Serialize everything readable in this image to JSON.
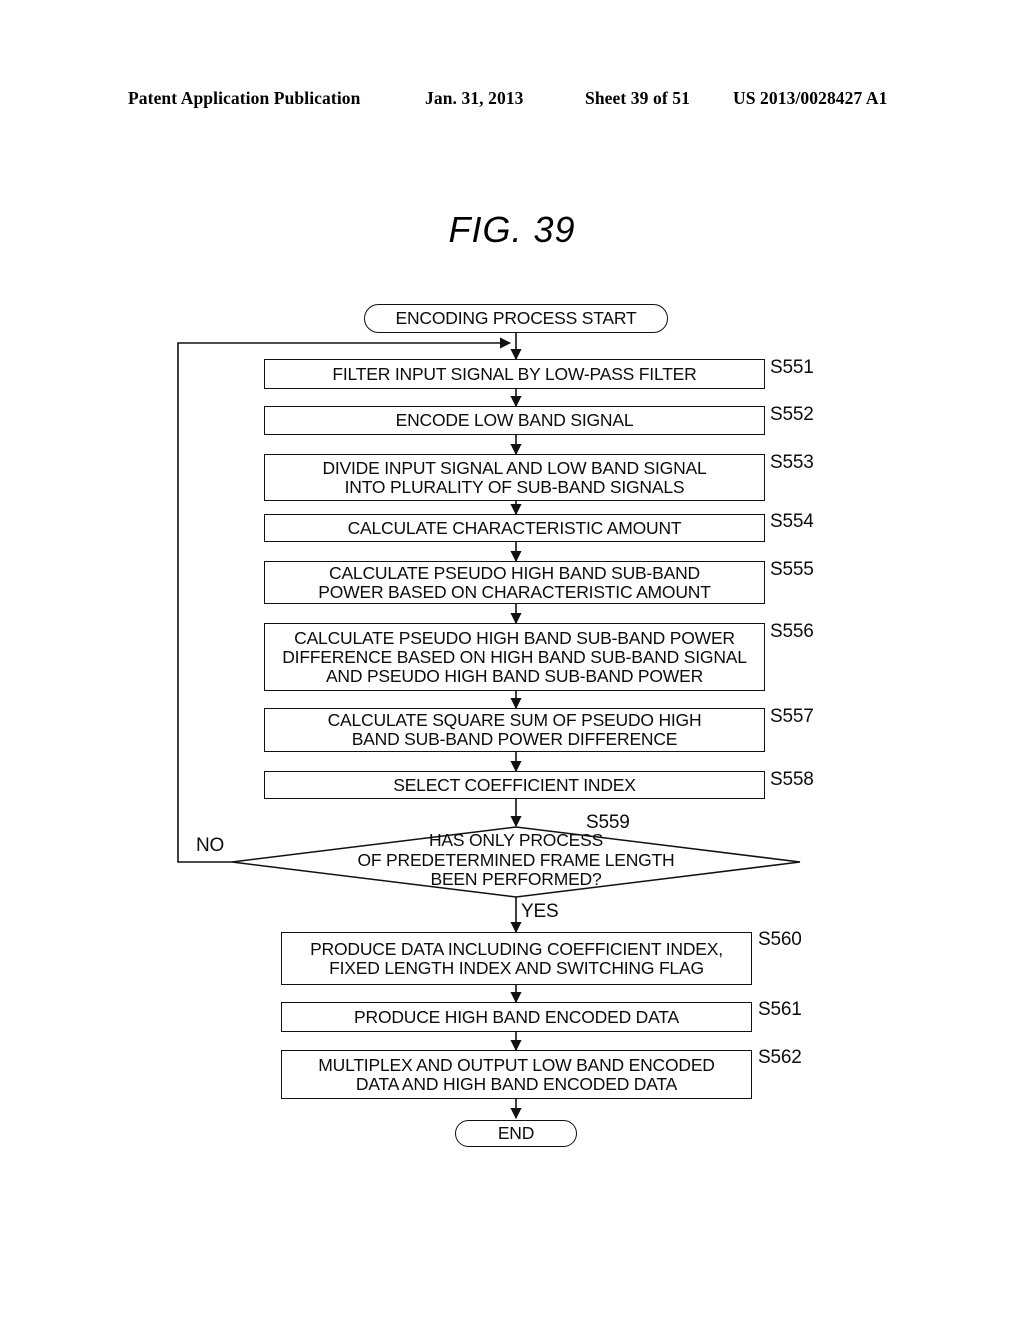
{
  "header": {
    "publication": "Patent Application Publication",
    "date": "Jan. 31, 2013",
    "sheet": "Sheet 39 of 51",
    "number": "US 2013/0028427 A1"
  },
  "figure": {
    "title": "FIG. 39"
  },
  "flowchart": {
    "start": {
      "label": "ENCODING PROCESS START"
    },
    "end": {
      "label": "END"
    },
    "steps": [
      {
        "id": "S551",
        "text": "FILTER INPUT SIGNAL BY LOW-PASS FILTER"
      },
      {
        "id": "S552",
        "text": "ENCODE LOW BAND SIGNAL"
      },
      {
        "id": "S553",
        "text": "DIVIDE INPUT SIGNAL AND LOW BAND SIGNAL\nINTO PLURALITY OF SUB-BAND SIGNALS"
      },
      {
        "id": "S554",
        "text": "CALCULATE CHARACTERISTIC AMOUNT"
      },
      {
        "id": "S555",
        "text": "CALCULATE PSEUDO HIGH BAND SUB-BAND\nPOWER BASED ON CHARACTERISTIC AMOUNT"
      },
      {
        "id": "S556",
        "text": "CALCULATE PSEUDO HIGH BAND SUB-BAND POWER\nDIFFERENCE BASED ON HIGH BAND SUB-BAND SIGNAL\nAND PSEUDO HIGH BAND SUB-BAND POWER"
      },
      {
        "id": "S557",
        "text": "CALCULATE SQUARE SUM OF PSEUDO HIGH\nBAND SUB-BAND POWER DIFFERENCE"
      },
      {
        "id": "S558",
        "text": "SELECT COEFFICIENT INDEX"
      },
      {
        "id": "S560",
        "text": "PRODUCE DATA INCLUDING COEFFICIENT INDEX,\nFIXED LENGTH INDEX AND SWITCHING FLAG"
      },
      {
        "id": "S561",
        "text": "PRODUCE HIGH BAND ENCODED DATA"
      },
      {
        "id": "S562",
        "text": "MULTIPLEX AND OUTPUT LOW BAND ENCODED\nDATA AND HIGH BAND ENCODED DATA"
      }
    ],
    "decision": {
      "id": "S559",
      "text": "HAS ONLY PROCESS\nOF PREDETERMINED FRAME LENGTH\nBEEN PERFORMED?",
      "branch_no": "NO",
      "branch_yes": "YES"
    }
  },
  "colors": {
    "ink": "#111111",
    "paper": "#ffffff"
  }
}
